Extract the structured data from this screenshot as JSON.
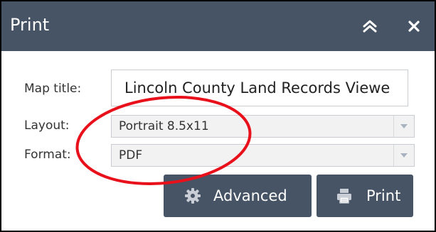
{
  "window": {
    "title": "Print",
    "collapse_icon": "double-chevron-up-icon",
    "close_icon": "close-icon"
  },
  "form": {
    "map_title_label": "Map title:",
    "map_title_value": "Lincoln County Land Records Viewe",
    "layout_label": "Layout:",
    "layout_value": "Portrait 8.5x11",
    "format_label": "Format:",
    "format_value": "PDF"
  },
  "buttons": {
    "advanced_label": "Advanced",
    "advanced_icon": "gear-icon",
    "print_label": "Print",
    "print_icon": "printer-icon"
  },
  "annotation": {
    "shape": "ellipse",
    "color": "#e8101a"
  },
  "colors": {
    "header": "#475466",
    "button": "#475466",
    "select_bg": "#f2f2f2"
  }
}
